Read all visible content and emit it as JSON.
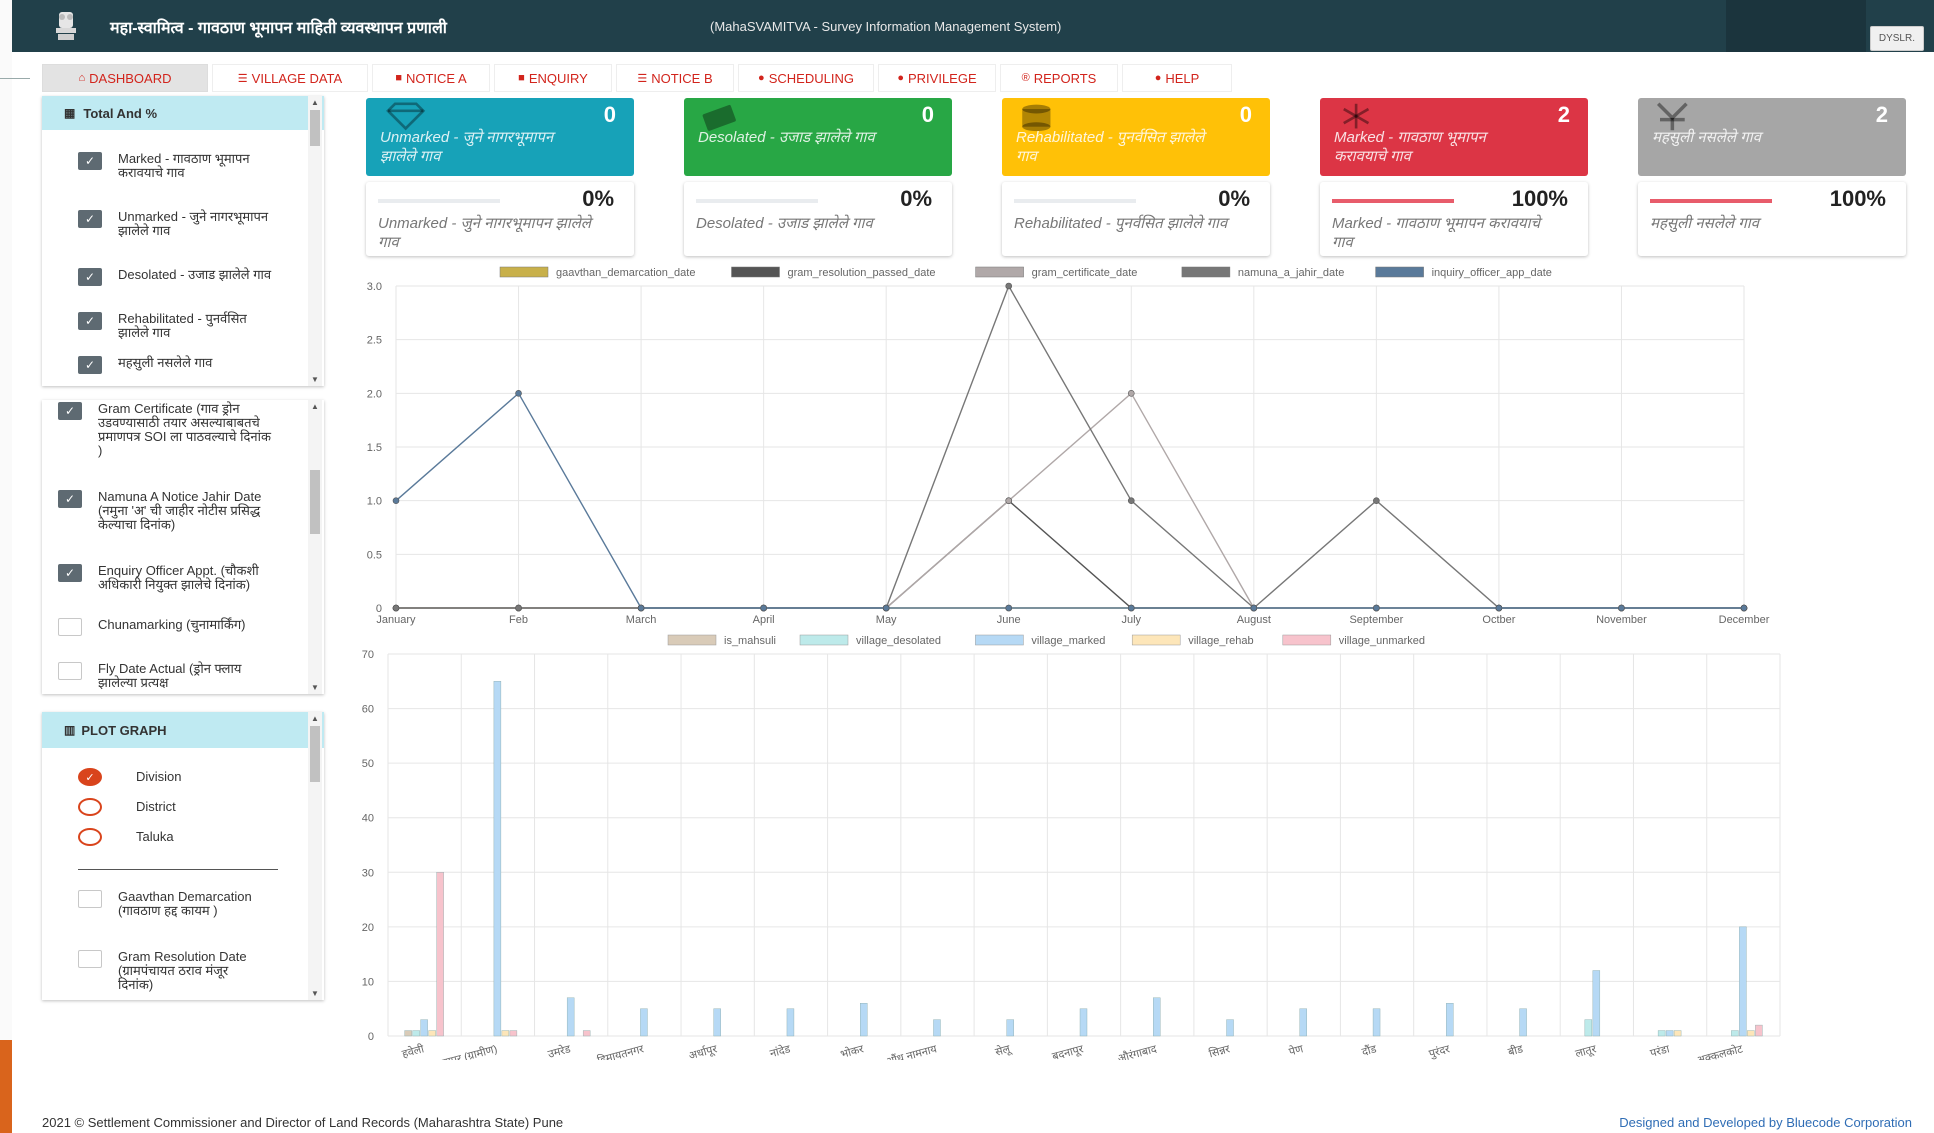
{
  "header": {
    "title": "महा-स्वामित्व - गावठाण भूमापन माहिती व्यवस्थापन प्रणाली",
    "subtitle": "(MahaSVAMITVA - Survey Information Management System)",
    "user": "DYSLR."
  },
  "tabs": [
    {
      "label": "DASHBOARD",
      "icon": "home-icon",
      "glyph": "⌂"
    },
    {
      "label": "VILLAGE DATA",
      "icon": "database-icon",
      "glyph": "☰"
    },
    {
      "label": "NOTICE A",
      "icon": "file-icon",
      "glyph": "■"
    },
    {
      "label": "ENQUIRY",
      "icon": "file-icon",
      "glyph": "■"
    },
    {
      "label": "NOTICE B",
      "icon": "list-icon",
      "glyph": "☰"
    },
    {
      "label": "SCHEDULING",
      "icon": "chat-icon",
      "glyph": "●"
    },
    {
      "label": "PRIVILEGE",
      "icon": "chat-icon",
      "glyph": "●"
    },
    {
      "label": "REPORTS",
      "icon": "registered-icon",
      "glyph": "®"
    },
    {
      "label": "HELP",
      "icon": "info-icon",
      "glyph": "●"
    }
  ],
  "total_panel": {
    "title": "Total And %",
    "items": [
      {
        "label": "Marked - गावठाण भूमापन करावयाचे गाव",
        "checked": true
      },
      {
        "label": "Unmarked - जुने नागरभूमापन झालेले गाव",
        "checked": true
      },
      {
        "label": "Desolated - उजाड झालेले गाव",
        "checked": true
      },
      {
        "label": "Rehabilitated - पुनर्वसित झालेले गाव",
        "checked": true
      },
      {
        "label": "महसुली नसलेले गाव",
        "checked": true
      }
    ]
  },
  "date_panel": {
    "items": [
      {
        "label": "Gram Certificate (गाव ड्रोन उडवण्यासाठी तयार असल्याबाबतचे प्रमाणपत्र SOI ला पाठवल्याचे दिनांक )",
        "checked": true
      },
      {
        "label": "Namuna A Notice Jahir Date (नमुना 'अ' ची जाहीर नोटीस प्रसिद्ध केल्याचा दिनांक)",
        "checked": true
      },
      {
        "label": "Enquiry Officer Appt. (चौकशी अधिकारी नियुक्त झालेचे दिनांक)",
        "checked": true
      },
      {
        "label": "Chunamarking (चुनामार्किंग)",
        "checked": false
      },
      {
        "label": "Fly Date Actual (ड्रोन फ्लाय झालेल्या प्रत्यक्ष",
        "checked": false
      }
    ]
  },
  "plot_panel": {
    "title": "PLOT GRAPH",
    "radios": [
      {
        "label": "Division",
        "selected": true
      },
      {
        "label": "District",
        "selected": false
      },
      {
        "label": "Taluka",
        "selected": false
      }
    ],
    "checks": [
      {
        "label": "Gaavthan Demarcation (गावठाण हद्द कायम )",
        "checked": false
      },
      {
        "label": "Gram Resolution Date (ग्रामपंचायत ठराव मंजूर दिनांक)",
        "checked": false
      }
    ]
  },
  "cards": [
    {
      "value": "0",
      "label": "Unmarked - जुने नागरभूमापन झालेले गाव",
      "color": "#17a2b8",
      "icon": "diamond-icon"
    },
    {
      "value": "0",
      "label": "Desolated - उजाड झालेले गाव",
      "color": "#28a745",
      "icon": "money-icon"
    },
    {
      "value": "0",
      "label": "Rehabilitated - पुनर्वसित झालेले गाव",
      "color": "#ffc107",
      "icon": "coins-icon"
    },
    {
      "value": "2",
      "label": "Marked - गावठाण भूमापन करावयाचे गाव",
      "color": "#dc3545",
      "icon": "snowflake-icon"
    },
    {
      "value": "2",
      "label": "महसुली नसलेले गाव",
      "color": "#a6a6a6",
      "icon": "yen-icon"
    }
  ],
  "progress_cards": [
    {
      "percent": "0%",
      "fill": 0,
      "label": "Unmarked - जुने नागरभूमापन झालेले गाव"
    },
    {
      "percent": "0%",
      "fill": 0,
      "label": "Desolated - उजाड झालेले गाव"
    },
    {
      "percent": "0%",
      "fill": 0,
      "label": "Rehabilitated - पुनर्वसित झालेले गाव"
    },
    {
      "percent": "100%",
      "fill": 1,
      "label": "Marked - गावठाण भूमापन करावयाचे गाव"
    },
    {
      "percent": "100%",
      "fill": 1,
      "label": "महसुली नसलेले गाव"
    }
  ],
  "chart_data": [
    {
      "type": "line",
      "categories": [
        "January",
        "Feb",
        "March",
        "April",
        "May",
        "June",
        "July",
        "August",
        "September",
        "Octber",
        "November",
        "December"
      ],
      "ylim": [
        0,
        3
      ],
      "yticks": [
        "0",
        "0.5",
        "1.0",
        "1.5",
        "2.0",
        "2.5",
        "3.0"
      ],
      "grid": true,
      "legend_position": "top",
      "series": [
        {
          "name": "gaavthan_demarcation_date",
          "color": "#c8b04a",
          "values": [
            0,
            0,
            0,
            0,
            0,
            0,
            0,
            0,
            0,
            0,
            0,
            0
          ]
        },
        {
          "name": "gram_resolution_passed_date",
          "color": "#555555",
          "values": [
            0,
            0,
            0,
            0,
            0,
            1,
            0,
            0,
            0,
            0,
            0,
            0
          ]
        },
        {
          "name": "gram_certificate_date",
          "color": "#b0a8a8",
          "values": [
            0,
            0,
            0,
            0,
            0,
            1,
            2,
            0,
            0,
            0,
            0,
            0
          ]
        },
        {
          "name": "namuna_a_jahir_date",
          "color": "#777777",
          "values": [
            0,
            0,
            0,
            0,
            0,
            3,
            1,
            0,
            1,
            0,
            0,
            0
          ]
        },
        {
          "name": "inquiry_officer_app_date",
          "color": "#5a7a9a",
          "values": [
            1,
            2,
            0,
            0,
            0,
            0,
            0,
            0,
            0,
            0,
            0,
            0
          ]
        }
      ]
    },
    {
      "type": "bar",
      "categories": [
        "हवेली",
        "नागपूर (ग्रामीण)",
        "उमरेड",
        "हिमायतनगर",
        "अर्धापूर",
        "नांदेड",
        "भोकर",
        "औंध नामनाय",
        "सेलू",
        "बदनापूर",
        "औरंगाबाद",
        "सिन्नर",
        "पेण",
        "दौंड",
        "पुरंदर",
        "बीड",
        "लातूर",
        "परंडा",
        "अक्कलकोट"
      ],
      "ylim": [
        0,
        70
      ],
      "yticks": [
        "0",
        "10",
        "20",
        "30",
        "40",
        "50",
        "60",
        "70"
      ],
      "grid": true,
      "legend_position": "top",
      "series": [
        {
          "name": "is_mahsuli",
          "color": "#d9cbb8",
          "values": [
            1,
            0,
            0,
            0,
            0,
            0,
            0,
            0,
            0,
            0,
            0,
            0,
            0,
            0,
            0,
            0,
            0,
            0,
            0
          ]
        },
        {
          "name": "village_desolated",
          "color": "#bdeaea",
          "values": [
            1,
            0,
            0,
            0,
            0,
            0,
            0,
            0,
            0,
            0,
            0,
            0,
            0,
            0,
            0,
            0,
            3,
            1,
            1
          ]
        },
        {
          "name": "village_marked",
          "color": "#b6d9f5",
          "values": [
            3,
            65,
            7,
            5,
            5,
            5,
            6,
            3,
            3,
            5,
            7,
            3,
            5,
            5,
            6,
            5,
            12,
            1,
            20
          ]
        },
        {
          "name": "village_rehab",
          "color": "#fde6b9",
          "values": [
            1,
            1,
            0,
            0,
            0,
            0,
            0,
            0,
            0,
            0,
            0,
            0,
            0,
            0,
            0,
            0,
            0,
            1,
            1
          ]
        },
        {
          "name": "village_unmarked",
          "color": "#f7c3cc",
          "values": [
            30,
            1,
            1,
            0,
            0,
            0,
            0,
            0,
            0,
            0,
            0,
            0,
            0,
            0,
            0,
            0,
            0,
            0,
            2
          ]
        }
      ]
    }
  ],
  "footer": {
    "left": "2021 © Settlement Commissioner and Director of Land Records (Maharashtra State) Pune",
    "right": "Designed and Developed by Bluecode Corporation"
  }
}
